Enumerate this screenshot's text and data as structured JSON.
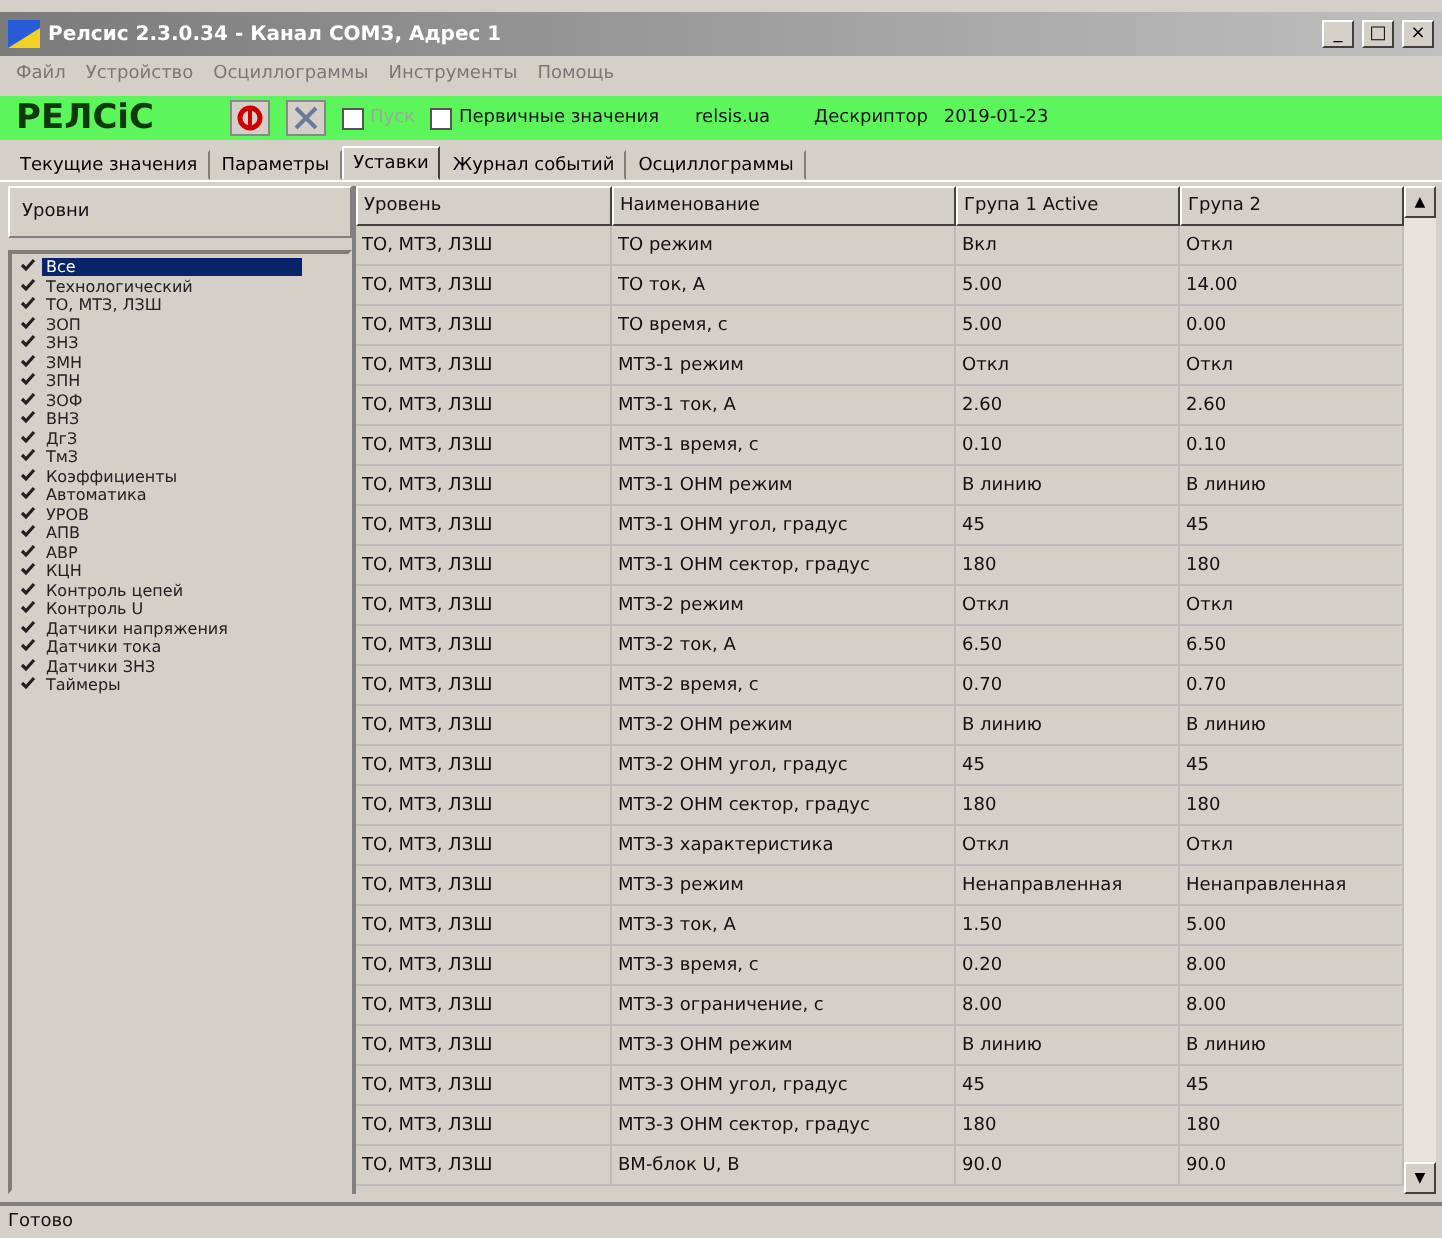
{
  "window": {
    "title": "Релсис 2.3.0.34 - Канал COM3, Адрес 1",
    "buttons": [
      "_",
      "□",
      "×"
    ]
  },
  "menu": [
    "Файл",
    "Устройство",
    "Осциллограммы",
    "Инструменты",
    "Помощь"
  ],
  "toolbar": {
    "logo": "РЕЛСіС",
    "start": {
      "label": "Пуск",
      "checked": false,
      "disabled": true
    },
    "primary": {
      "label": "Первичные значения",
      "checked": false
    },
    "site": "relsis.ua",
    "descriptor_label": "Дескриптор",
    "descriptor": "2019-01-23"
  },
  "tabs": [
    {
      "label": "Текущие значения",
      "selected": false
    },
    {
      "label": "Параметры",
      "selected": false
    },
    {
      "label": "Уставки",
      "selected": true
    },
    {
      "label": "Журнал событий",
      "selected": false
    },
    {
      "label": "Осциллограммы",
      "selected": false
    }
  ],
  "levels": {
    "title": "Уровни",
    "items": [
      {
        "label": "Все",
        "checked": true,
        "selected": true
      },
      {
        "label": "Технологический",
        "checked": true,
        "selected": false
      },
      {
        "label": "ТО, МТЗ, ЛЗШ",
        "checked": true,
        "selected": false
      },
      {
        "label": "ЗОП",
        "checked": true,
        "selected": false
      },
      {
        "label": "ЗНЗ",
        "checked": true,
        "selected": false
      },
      {
        "label": "ЗМН",
        "checked": true,
        "selected": false
      },
      {
        "label": "ЗПН",
        "checked": true,
        "selected": false
      },
      {
        "label": "ЗОФ",
        "checked": true,
        "selected": false
      },
      {
        "label": "ВНЗ",
        "checked": true,
        "selected": false
      },
      {
        "label": "ДгЗ",
        "checked": true,
        "selected": false
      },
      {
        "label": "ТмЗ",
        "checked": true,
        "selected": false
      },
      {
        "label": "Коэффициенты",
        "checked": true,
        "selected": false
      },
      {
        "label": "Автоматика",
        "checked": true,
        "selected": false
      },
      {
        "label": "УРОВ",
        "checked": true,
        "selected": false
      },
      {
        "label": "АПВ",
        "checked": true,
        "selected": false
      },
      {
        "label": "АВР",
        "checked": true,
        "selected": false
      },
      {
        "label": "КЦН",
        "checked": true,
        "selected": false
      },
      {
        "label": "Контроль цепей",
        "checked": true,
        "selected": false
      },
      {
        "label": "Контроль U",
        "checked": true,
        "selected": false
      },
      {
        "label": "Датчики напряжения",
        "checked": true,
        "selected": false
      },
      {
        "label": "Датчики тока",
        "checked": true,
        "selected": false
      },
      {
        "label": "Датчики ЗНЗ",
        "checked": true,
        "selected": false
      },
      {
        "label": "Таймеры",
        "checked": true,
        "selected": false
      }
    ]
  },
  "table": {
    "columns": [
      "Уровень",
      "Наименование",
      "Група 1 Active",
      "Група 2"
    ],
    "rows": [
      [
        "ТО, МТЗ, ЛЗШ",
        "ТО режим",
        "Вкл",
        "Откл"
      ],
      [
        "ТО, МТЗ, ЛЗШ",
        "ТО ток, А",
        "5.00",
        "14.00"
      ],
      [
        "ТО, МТЗ, ЛЗШ",
        "ТО время, с",
        "5.00",
        "0.00"
      ],
      [
        "ТО, МТЗ, ЛЗШ",
        "МТЗ-1 режим",
        "Откл",
        "Откл"
      ],
      [
        "ТО, МТЗ, ЛЗШ",
        "МТЗ-1 ток, А",
        "2.60",
        "2.60"
      ],
      [
        "ТО, МТЗ, ЛЗШ",
        "МТЗ-1 время, с",
        "0.10",
        "0.10"
      ],
      [
        "ТО, МТЗ, ЛЗШ",
        "МТЗ-1 ОНМ режим",
        "В линию",
        "В линию"
      ],
      [
        "ТО, МТЗ, ЛЗШ",
        "МТЗ-1 ОНМ угол, градус",
        "45",
        "45"
      ],
      [
        "ТО, МТЗ, ЛЗШ",
        "МТЗ-1 ОНМ сектор, градус",
        "180",
        "180"
      ],
      [
        "ТО, МТЗ, ЛЗШ",
        "МТЗ-2 режим",
        "Откл",
        "Откл"
      ],
      [
        "ТО, МТЗ, ЛЗШ",
        "МТЗ-2 ток, А",
        "6.50",
        "6.50"
      ],
      [
        "ТО, МТЗ, ЛЗШ",
        "МТЗ-2 время, с",
        "0.70",
        "0.70"
      ],
      [
        "ТО, МТЗ, ЛЗШ",
        "МТЗ-2 ОНМ режим",
        "В линию",
        "В линию"
      ],
      [
        "ТО, МТЗ, ЛЗШ",
        "МТЗ-2 ОНМ угол, градус",
        "45",
        "45"
      ],
      [
        "ТО, МТЗ, ЛЗШ",
        "МТЗ-2 ОНМ сектор, градус",
        "180",
        "180"
      ],
      [
        "ТО, МТЗ, ЛЗШ",
        "МТЗ-3 характеристика",
        "Откл",
        "Откл"
      ],
      [
        "ТО, МТЗ, ЛЗШ",
        "МТЗ-3 режим",
        "Ненаправленная",
        "Ненаправленная"
      ],
      [
        "ТО, МТЗ, ЛЗШ",
        "МТЗ-3 ток, А",
        "1.50",
        "5.00"
      ],
      [
        "ТО, МТЗ, ЛЗШ",
        "МТЗ-3 время, с",
        "0.20",
        "8.00"
      ],
      [
        "ТО, МТЗ, ЛЗШ",
        "МТЗ-3 ограничение, с",
        "8.00",
        "8.00"
      ],
      [
        "ТО, МТЗ, ЛЗШ",
        "МТЗ-3 ОНМ режим",
        "В линию",
        "В линию"
      ],
      [
        "ТО, МТЗ, ЛЗШ",
        "МТЗ-3 ОНМ угол, градус",
        "45",
        "45"
      ],
      [
        "ТО, МТЗ, ЛЗШ",
        "МТЗ-3 ОНМ сектор, градус",
        "180",
        "180"
      ],
      [
        "ТО, МТЗ, ЛЗШ",
        "ВМ-блок U, В",
        "90.0",
        "90.0"
      ]
    ]
  },
  "scroll_arrows": [
    "▲",
    "▼"
  ],
  "status_bar": "Готово"
}
